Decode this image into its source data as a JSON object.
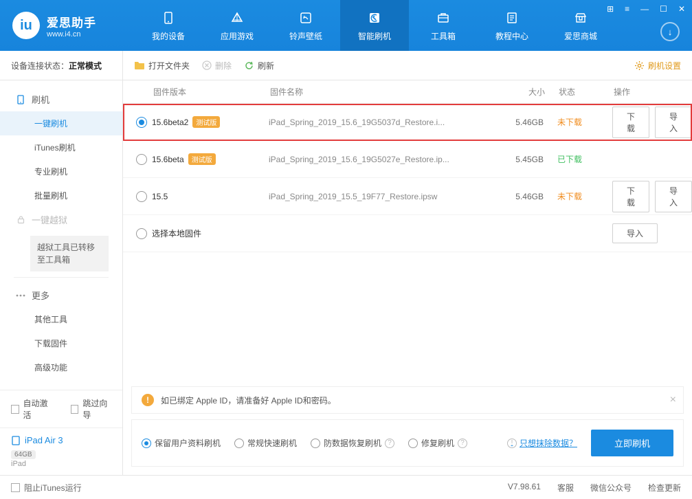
{
  "header": {
    "logo_title": "爱思助手",
    "logo_sub": "www.i4.cn",
    "tabs": [
      "我的设备",
      "应用游戏",
      "铃声壁纸",
      "智能刷机",
      "工具箱",
      "教程中心",
      "爱思商城"
    ]
  },
  "sidebar": {
    "status_label": "设备连接状态：",
    "status_value": "正常模式",
    "cat_flash": "刷机",
    "items_flash": [
      "一键刷机",
      "iTunes刷机",
      "专业刷机",
      "批量刷机"
    ],
    "cat_jailbreak": "一键越狱",
    "jailbreak_notice": "越狱工具已转移至工具箱",
    "cat_more": "更多",
    "items_more": [
      "其他工具",
      "下载固件",
      "高级功能"
    ],
    "auto_activate": "自动激活",
    "skip_guide": "跳过向导",
    "device_name": "iPad Air 3",
    "device_storage": "64GB",
    "device_type": "iPad"
  },
  "toolbar": {
    "open": "打开文件夹",
    "delete": "删除",
    "refresh": "刷新",
    "settings": "刷机设置"
  },
  "columns": {
    "version": "固件版本",
    "name": "固件名称",
    "size": "大小",
    "status": "状态",
    "ops": "操作"
  },
  "rows": [
    {
      "selected": true,
      "highlight": true,
      "version": "15.6beta2",
      "beta": "测试版",
      "name": "iPad_Spring_2019_15.6_19G5037d_Restore.i...",
      "size": "5.46GB",
      "status": "未下载",
      "status_cls": "notdl",
      "dl": "下载",
      "imp": "导入"
    },
    {
      "selected": false,
      "version": "15.6beta",
      "beta": "测试版",
      "name": "iPad_Spring_2019_15.6_19G5027e_Restore.ip...",
      "size": "5.45GB",
      "status": "已下载",
      "status_cls": "dl"
    },
    {
      "selected": false,
      "version": "15.5",
      "name": "iPad_Spring_2019_15.5_19F77_Restore.ipsw",
      "size": "5.46GB",
      "status": "未下载",
      "status_cls": "notdl",
      "dl": "下载",
      "imp": "导入"
    },
    {
      "selected": false,
      "version": "选择本地固件",
      "local": true,
      "imp": "导入"
    }
  ],
  "alert": "如已绑定 Apple ID，请准备好 Apple ID和密码。",
  "options": [
    "保留用户资料刷机",
    "常规快速刷机",
    "防数据恢复刷机",
    "修复刷机"
  ],
  "erase_link": "只想抹除数据？",
  "flash_btn": "立即刷机",
  "footer": {
    "block_itunes": "阻止iTunes运行",
    "version": "V7.98.61",
    "links": [
      "客服",
      "微信公众号",
      "检查更新"
    ]
  }
}
